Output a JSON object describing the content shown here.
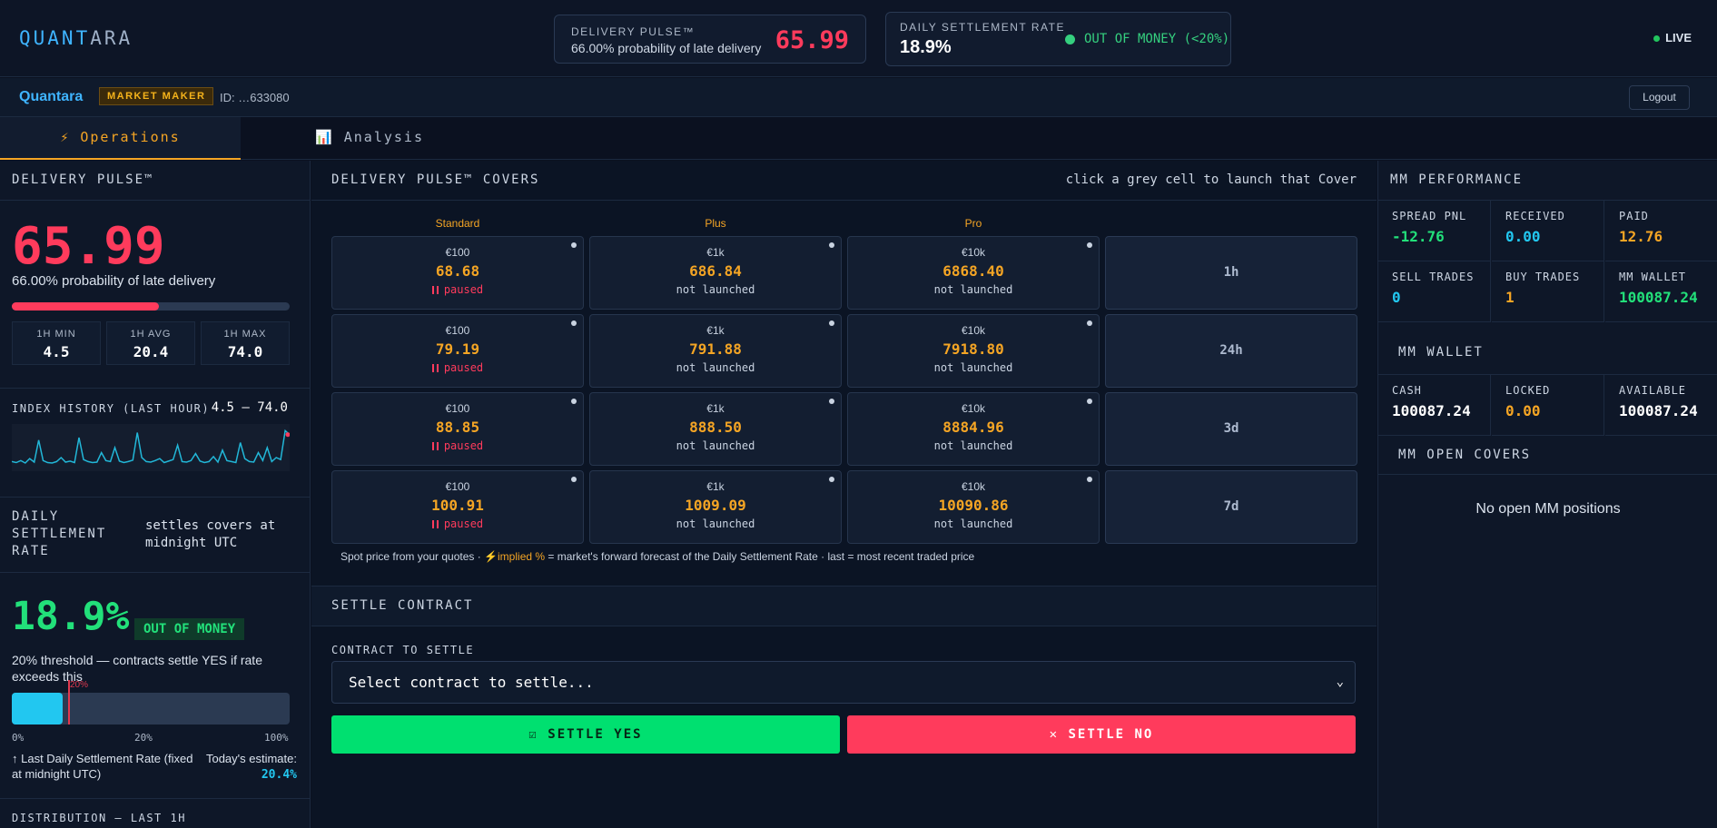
{
  "brand": {
    "part1": "QUANT",
    "part2": "ARA"
  },
  "header": {
    "pulse_label": "DELIVERY PULSE™",
    "pulse_sub": "66.00% probability of late delivery",
    "pulse_value": "65.99",
    "rate_label": "DAILY SETTLEMENT RATE",
    "rate_value": "18.9%",
    "rate_status": "OUT OF MONEY (<20%)",
    "live": "LIVE"
  },
  "user": {
    "name": "Quantara",
    "role": "MARKET MAKER",
    "id": "ID: …633080",
    "logout": "Logout"
  },
  "tabs": [
    {
      "icon": "⚡",
      "label": "Operations"
    },
    {
      "icon": "📊",
      "label": "Analysis"
    }
  ],
  "left": {
    "title": "DELIVERY PULSE™",
    "value": "65.99",
    "probability": "66.00% probability of late delivery",
    "probability_fraction": 0.66,
    "stats": [
      {
        "label": "1H MIN",
        "value": "4.5"
      },
      {
        "label": "1H AVG",
        "value": "20.4"
      },
      {
        "label": "1H MAX",
        "value": "74.0"
      }
    ],
    "history_label": "INDEX HISTORY (LAST HOUR)",
    "history_range": "4.5 – 74.0",
    "history": [
      12,
      10,
      14,
      9,
      18,
      11,
      55,
      14,
      10,
      9,
      12,
      20,
      11,
      13,
      10,
      60,
      16,
      12,
      10,
      11,
      30,
      14,
      12,
      40,
      13,
      10,
      12,
      15,
      70,
      20,
      12,
      11,
      14,
      18,
      10,
      13,
      16,
      45,
      12,
      11,
      14,
      28,
      13,
      10,
      12,
      22,
      11,
      35,
      14,
      12,
      10,
      50,
      18,
      12,
      11,
      30,
      14,
      40,
      12,
      20,
      16,
      74,
      66
    ]
  },
  "dsr": {
    "title": "DAILY SETTLEMENT RATE",
    "note": "settles covers at midnight UTC",
    "value": "18.9%",
    "badge": "OUT OF MONEY",
    "threshold_text": "20% threshold — contracts settle YES if rate exceeds this",
    "rate_fraction": 0.189,
    "threshold_fraction": 0.2,
    "threshold_mark": "20%",
    "scale": [
      "0%",
      "20%",
      "100%"
    ],
    "last_text": "↑ Last Daily Settlement Rate (fixed at midnight UTC)",
    "estimate_label": "Today's estimate:",
    "estimate_value": "20.4%",
    "distribution_label": "DISTRIBUTION — LAST 1H"
  },
  "covers": {
    "title": "DELIVERY PULSE™ COVERS",
    "hint": "click a grey cell to launch that Cover",
    "columns": [
      "Standard",
      "Plus",
      "Pro"
    ],
    "rows": [
      {
        "tenor": "1h",
        "cells": [
          {
            "notional": "€100",
            "price": "68.68",
            "status": "paused"
          },
          {
            "notional": "€1k",
            "price": "686.84",
            "status": "not launched"
          },
          {
            "notional": "€10k",
            "price": "6868.40",
            "status": "not launched"
          }
        ]
      },
      {
        "tenor": "24h",
        "cells": [
          {
            "notional": "€100",
            "price": "79.19",
            "status": "paused"
          },
          {
            "notional": "€1k",
            "price": "791.88",
            "status": "not launched"
          },
          {
            "notional": "€10k",
            "price": "7918.80",
            "status": "not launched"
          }
        ]
      },
      {
        "tenor": "3d",
        "cells": [
          {
            "notional": "€100",
            "price": "88.85",
            "status": "paused"
          },
          {
            "notional": "€1k",
            "price": "888.50",
            "status": "not launched"
          },
          {
            "notional": "€10k",
            "price": "8884.96",
            "status": "not launched"
          }
        ]
      },
      {
        "tenor": "7d",
        "cells": [
          {
            "notional": "€100",
            "price": "100.91",
            "status": "paused"
          },
          {
            "notional": "€1k",
            "price": "1009.09",
            "status": "not launched"
          },
          {
            "notional": "€10k",
            "price": "10090.86",
            "status": "not launched"
          }
        ]
      }
    ],
    "footnote_a": "Spot price from your quotes  ·  ",
    "footnote_b": "⚡implied %",
    "footnote_c": " = market's forward forecast of the Daily Settlement Rate  ·  last = most recent traded price"
  },
  "settle": {
    "title": "SETTLE CONTRACT",
    "field_label": "CONTRACT TO SETTLE",
    "placeholder": "Select contract to settle...",
    "yes": "☑  SETTLE YES",
    "no": "✕  SETTLE NO"
  },
  "perf": {
    "title": "MM PERFORMANCE",
    "metrics": [
      {
        "label": "SPREAD PNL",
        "value": "-12.76",
        "color": "#22e07a"
      },
      {
        "label": "RECEIVED",
        "value": "0.00",
        "color": "#22c7f0"
      },
      {
        "label": "PAID",
        "value": "12.76",
        "color": "#f5a524"
      },
      {
        "label": "SELL TRADES",
        "value": "0",
        "color": "#22c7f0"
      },
      {
        "label": "BUY TRADES",
        "value": "1",
        "color": "#f5a524"
      },
      {
        "label": "MM WALLET",
        "value": "100087.24",
        "color": "#22e07a"
      }
    ],
    "wallet_title": "MM WALLET",
    "wallet": [
      {
        "label": "CASH",
        "value": "100087.24",
        "color": "#ffffff"
      },
      {
        "label": "LOCKED",
        "value": "0.00",
        "color": "#f5a524"
      },
      {
        "label": "AVAILABLE",
        "value": "100087.24",
        "color": "#ffffff"
      }
    ],
    "open_title": "MM OPEN COVERS",
    "open_empty": "No open MM positions"
  }
}
